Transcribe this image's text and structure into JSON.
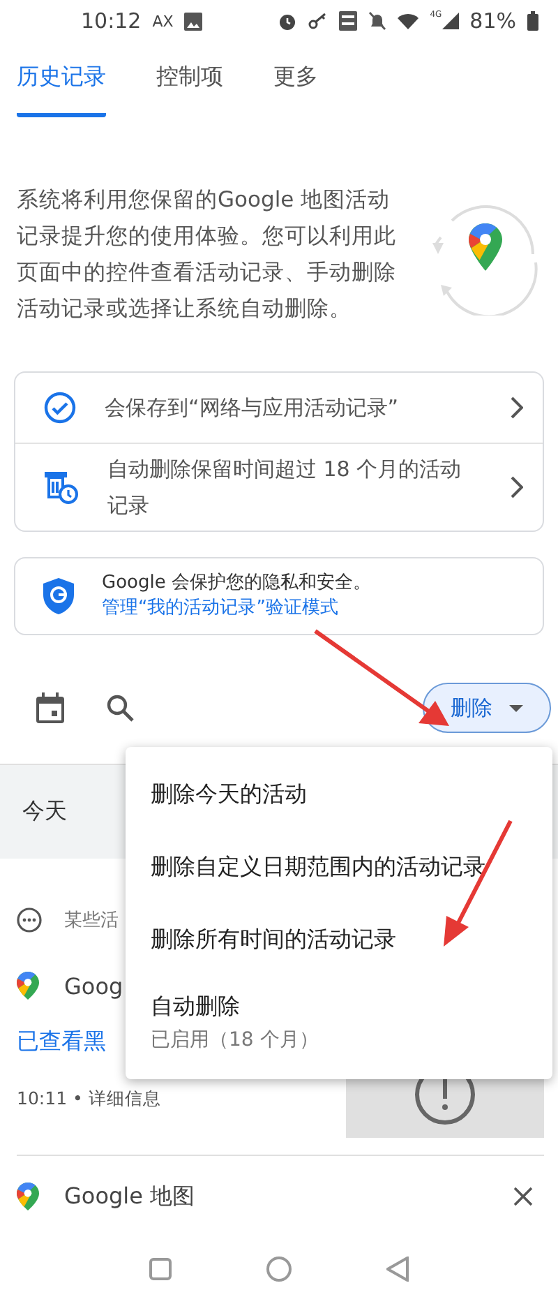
{
  "status_bar": {
    "time": "10:12",
    "carrier": "AX",
    "network": "4G",
    "battery": "81%"
  },
  "tabs": [
    {
      "label": "历史记录",
      "selected": true
    },
    {
      "label": "控制项",
      "selected": false
    },
    {
      "label": "更多",
      "selected": false
    }
  ],
  "intro": {
    "text": "系统将利用您保留的Google 地图活动记录提升您的使用体验。您可以利用此页面中的控件查看活动记录、手动删除活动记录或选择让系统自动删除。"
  },
  "settings_card": {
    "items": [
      {
        "kind": "saving",
        "text": "会保存到“网络与应用活动记录”"
      },
      {
        "kind": "auto_delete",
        "text": "自动删除保留时间超过 18 个月的活动记录"
      }
    ]
  },
  "privacy_card": {
    "text": "Google 会保护您的隐私和安全。",
    "link": "管理“我的活动记录”验证模式"
  },
  "toolbar": {
    "delete_button": "删除"
  },
  "delete_menu": {
    "open": true,
    "items": [
      {
        "label": "删除今天的活动"
      },
      {
        "label": "删除自定义日期范围内的活动记录"
      },
      {
        "label": "删除所有时间的活动记录"
      },
      {
        "label": "自动删除",
        "detail": "已启用（18 个月）"
      }
    ]
  },
  "history": {
    "day": "今天",
    "notice": "某些活",
    "entries": [
      {
        "app": "Goog",
        "title": "已查看黑",
        "meta": "10:11 • 详细信息",
        "thumbnail": true
      },
      {
        "app": "Google 地图"
      }
    ]
  }
}
